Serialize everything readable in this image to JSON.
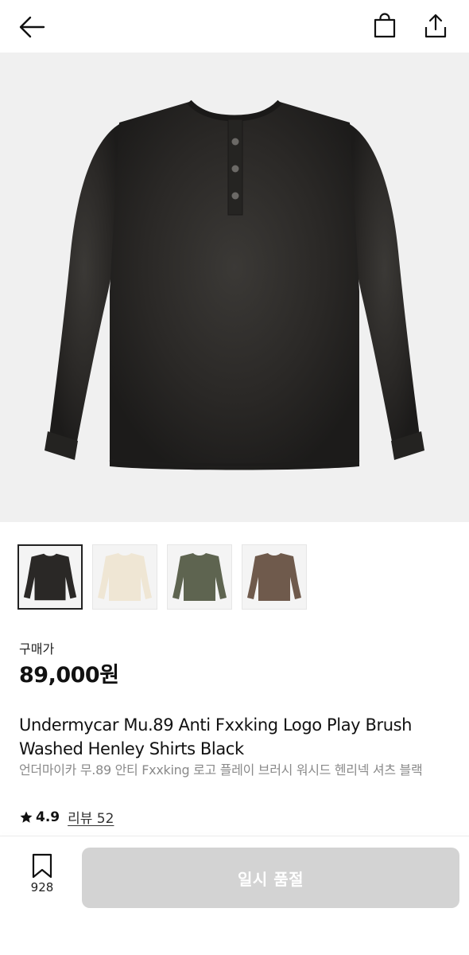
{
  "header": {
    "back_icon": "arrow-left-icon",
    "bag_icon": "shopping-bag-icon",
    "share_icon": "share-icon"
  },
  "product": {
    "main_image_color": "#2c2a28",
    "thumbnails": [
      {
        "color": "#2a2826",
        "selected": true
      },
      {
        "color": "#efe6d4",
        "selected": false
      },
      {
        "color": "#5e6450",
        "selected": false
      },
      {
        "color": "#6f5a4c",
        "selected": false
      }
    ],
    "price_label": "구매가",
    "price": "89,000원",
    "title": "Undermycar Mu.89 Anti Fxxking Logo Play Brush Washed Henley Shirts Black",
    "subtitle": "언더마이카 무.89 안티 Fxxking 로고 플레이 브러시 워시드 헨리넥 셔츠 블랙",
    "rating": "4.9",
    "review_text": "리뷰 52"
  },
  "bottom_bar": {
    "wish_icon": "bookmark-icon",
    "wish_count": "928",
    "cta_label": "일시 품절",
    "cta_color": "#d3d3d3"
  }
}
